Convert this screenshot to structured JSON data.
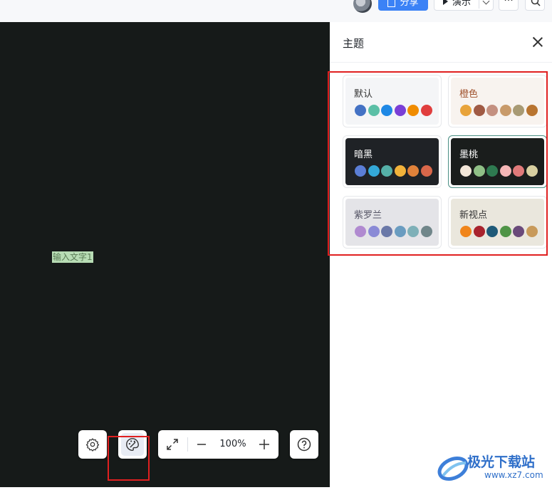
{
  "topbar": {
    "share_label": "分享",
    "present_label": "演示",
    "more_label": "···"
  },
  "canvas": {
    "text_node": "输入文字1",
    "background": "#161a19"
  },
  "toolbar": {
    "zoom_level": "100%"
  },
  "panel": {
    "title": "主题",
    "themes": [
      {
        "name": "默认",
        "bg": "#f4f5f7",
        "text_color": "#333333",
        "colors": [
          "#4472c4",
          "#5bbfa6",
          "#1e88e5",
          "#7a3fd6",
          "#f08c00",
          "#e03e3e"
        ],
        "selected": false
      },
      {
        "name": "橙色",
        "bg": "#f8f3ef",
        "text_color": "#a0522d",
        "colors": [
          "#e8a33a",
          "#a05a44",
          "#c49080",
          "#c89a6a",
          "#a89a74",
          "#b87430"
        ],
        "selected": false
      },
      {
        "name": "暗黑",
        "bg": "#1f2226",
        "text_color": "#ffffff",
        "colors": [
          "#5b7ed6",
          "#34a8d8",
          "#55b0a8",
          "#f2b23a",
          "#e0823a",
          "#d9674a"
        ],
        "selected": false
      },
      {
        "name": "墨桃",
        "bg": "#1a1d1c",
        "text_color": "#ffffff",
        "colors": [
          "#f2e6d8",
          "#8fbf86",
          "#2e7a50",
          "#f4b6b6",
          "#e07a7a",
          "#d8cfa0"
        ],
        "selected": true
      },
      {
        "name": "紫罗兰",
        "bg": "#e4e4e8",
        "text_color": "#555566",
        "colors": [
          "#b08ad0",
          "#8a8ad6",
          "#6a78a8",
          "#6a9cc0",
          "#7eb0b8",
          "#70868a"
        ],
        "selected": false
      },
      {
        "name": "新视点",
        "bg": "#eae7dd",
        "text_color": "#333333",
        "colors": [
          "#f0851a",
          "#a8232d",
          "#1f5a78",
          "#4f9446",
          "#6a4a7a",
          "#c89a5a"
        ],
        "selected": false
      }
    ]
  },
  "watermark": {
    "brand": "极光下载站",
    "url": "www.xz7.com"
  }
}
